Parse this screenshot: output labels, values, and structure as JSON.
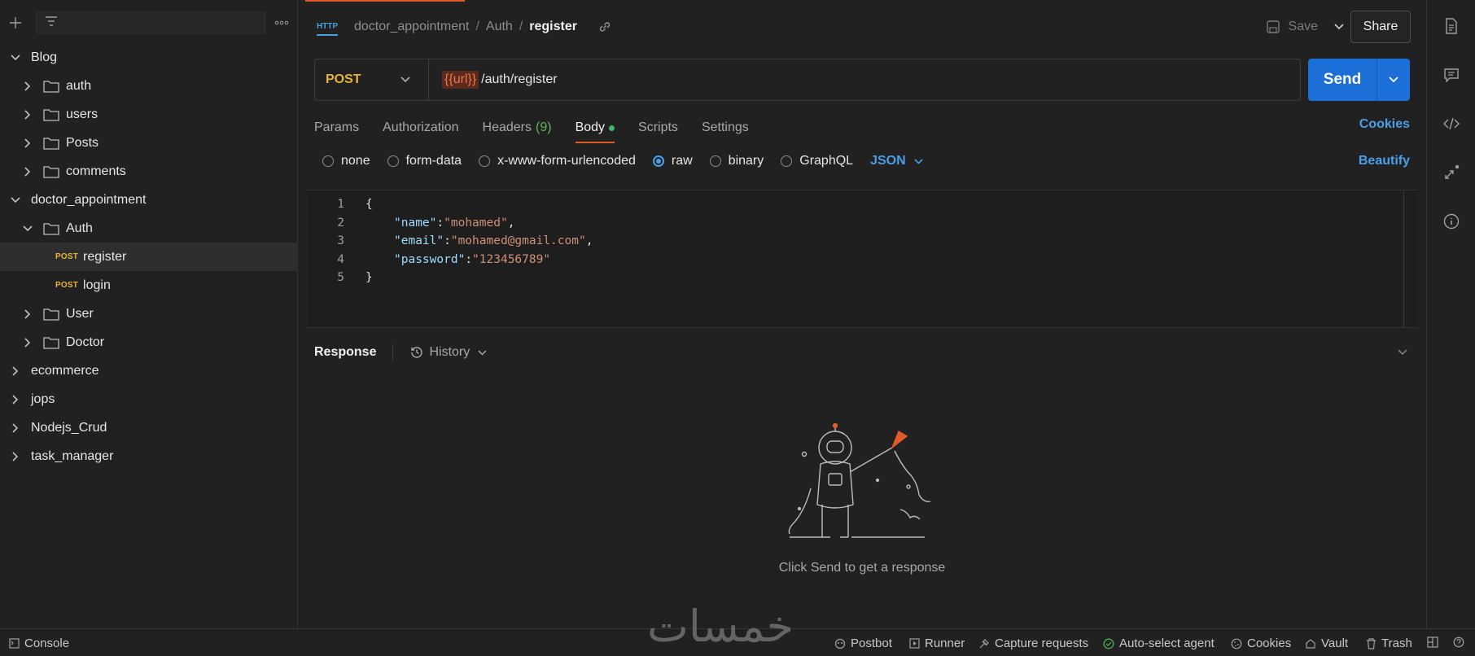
{
  "sidebar": {
    "tree": [
      {
        "label": "Blog",
        "level": 0,
        "expanded": true,
        "kind": "collection"
      },
      {
        "label": "auth",
        "level": 1,
        "expanded": false,
        "kind": "folder"
      },
      {
        "label": "users",
        "level": 1,
        "expanded": false,
        "kind": "folder"
      },
      {
        "label": "Posts",
        "level": 1,
        "expanded": false,
        "kind": "folder"
      },
      {
        "label": "comments",
        "level": 1,
        "expanded": false,
        "kind": "folder"
      },
      {
        "label": "doctor_appointment",
        "level": 0,
        "expanded": true,
        "kind": "collection"
      },
      {
        "label": "Auth",
        "level": 1,
        "expanded": true,
        "kind": "folder"
      },
      {
        "label": "register",
        "level": 2,
        "method": "POST",
        "kind": "request",
        "selected": true
      },
      {
        "label": "login",
        "level": 2,
        "method": "POST",
        "kind": "request"
      },
      {
        "label": "User",
        "level": 1,
        "expanded": false,
        "kind": "folder"
      },
      {
        "label": "Doctor",
        "level": 1,
        "expanded": false,
        "kind": "folder"
      },
      {
        "label": "ecommerce",
        "level": 0,
        "expanded": false,
        "kind": "collection"
      },
      {
        "label": "jops",
        "level": 0,
        "expanded": false,
        "kind": "collection"
      },
      {
        "label": "Nodejs_Crud",
        "level": 0,
        "expanded": false,
        "kind": "collection"
      },
      {
        "label": "task_manager",
        "level": 0,
        "expanded": false,
        "kind": "collection"
      }
    ]
  },
  "header": {
    "http_badge": "HTTP",
    "breadcrumb": [
      "doctor_appointment",
      "Auth",
      "register"
    ],
    "sep": "/",
    "save_label": "Save",
    "share_label": "Share"
  },
  "request": {
    "method": "POST",
    "url_var": "{{url}}",
    "url_path": "/auth/register",
    "send_label": "Send"
  },
  "tabs": [
    {
      "label": "Params"
    },
    {
      "label": "Authorization"
    },
    {
      "label": "Headers",
      "count": "(9)"
    },
    {
      "label": "Body",
      "active": true
    },
    {
      "label": "Scripts"
    },
    {
      "label": "Settings"
    }
  ],
  "cookies_label": "Cookies",
  "body_options": [
    {
      "label": "none",
      "selected": false
    },
    {
      "label": "form-data",
      "selected": false
    },
    {
      "label": "x-www-form-urlencoded",
      "selected": false
    },
    {
      "label": "raw",
      "selected": true
    },
    {
      "label": "binary",
      "selected": false
    },
    {
      "label": "GraphQL",
      "selected": false
    }
  ],
  "body_format": "JSON",
  "beautify_label": "Beautify",
  "editor": {
    "lines": [
      {
        "n": "1",
        "text": "{"
      },
      {
        "n": "2",
        "key": "\"name\"",
        "value": "\"mohamed\"",
        "trail": ","
      },
      {
        "n": "3",
        "key": "\"email\"",
        "value": "\"mohamed@gmail.com\"",
        "trail": ","
      },
      {
        "n": "4",
        "key": "\"password\"",
        "value": "\"123456789\"",
        "trail": ""
      },
      {
        "n": "5",
        "text": "}"
      }
    ]
  },
  "response": {
    "title": "Response",
    "history_label": "History",
    "empty_message": "Click Send to get a response"
  },
  "statusbar": {
    "console": "Console",
    "postbot": "Postbot",
    "runner": "Runner",
    "capture": "Capture requests",
    "auto_select": "Auto-select agent",
    "cookies": "Cookies",
    "vault": "Vault",
    "trash": "Trash"
  },
  "watermark": "خمسات",
  "colors": {
    "accent_orange": "#e05b2a",
    "send_blue": "#1b6fd6",
    "link_blue": "#4a9fe8",
    "method_post": "#e6b33b"
  }
}
